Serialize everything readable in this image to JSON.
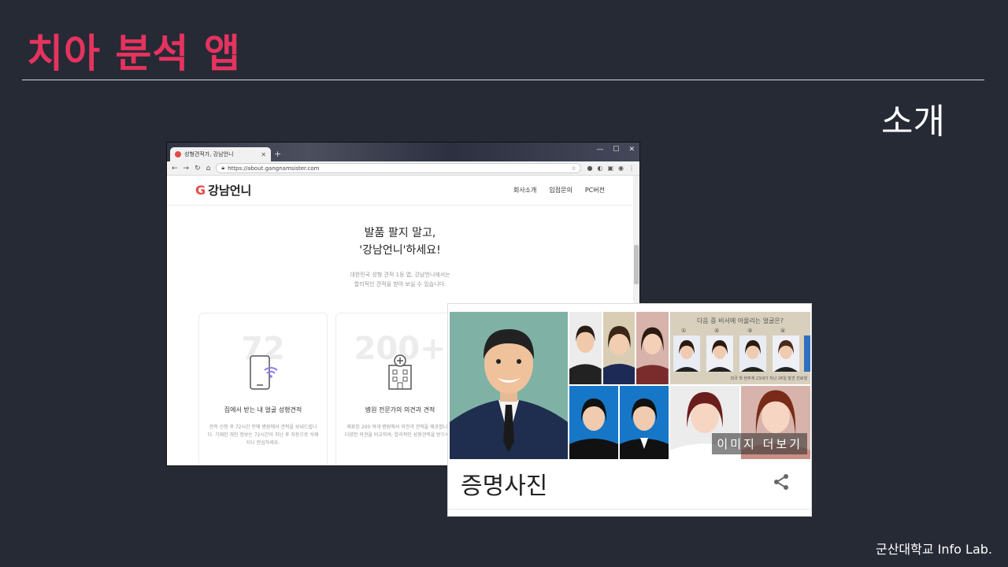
{
  "slide": {
    "title": "치아 분석 앱",
    "subtitle": "소개",
    "footer": "군산대학교 Info Lab."
  },
  "browser": {
    "tab_title": "성형견적가, 강남언니",
    "url": "https://about.gangnamsister.com",
    "site": {
      "logo_text": "강남언니",
      "nav": [
        "회사소개",
        "입점문의",
        "PC버전"
      ],
      "hero_line1": "발품 팔지 말고,",
      "hero_line2": "'강남언니'하세요!",
      "hero_desc1": "대한민국 성형 견적 1등 앱, 강남언니에서는",
      "hero_desc2": "합리적인 견적을 받아 보실 수 있습니다.",
      "cards": [
        {
          "number": "72",
          "title": "집에서 받는 내 얼굴 성형견적",
          "desc": "견적 신청 후 72시간 안에 병원에서 견적을 보내드립니다. 기재한 개인 정보는 72시간이 지난 후 자동으로 삭제되니 안심하세요."
        },
        {
          "number": "200+",
          "title": "병원 전문가의 의견과 견적",
          "desc": "제휴된 200 여개 병원에서 의견과 견적을 제공합니다. 다양한 의견을 비교하여, 합리적인 성형견적을 받으세요."
        }
      ]
    }
  },
  "google_card": {
    "chart_caption": "다음 증 비서에 어울리는 얼굴은?",
    "chart_numbers": [
      "①",
      "②",
      "③",
      "④"
    ],
    "chart_footnote": "외국 학 현주계 23세기 지난 26일 발견 진료행",
    "more_images": "이미지 더보기",
    "title": "증명사진"
  }
}
